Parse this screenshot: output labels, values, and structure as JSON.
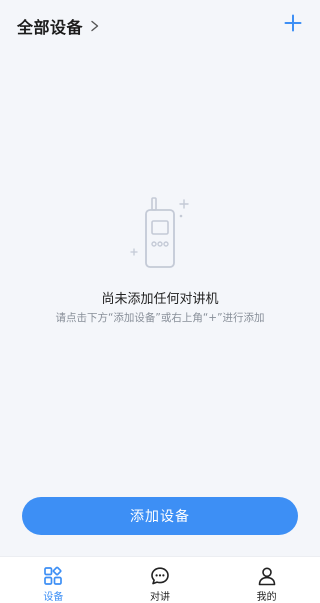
{
  "header": {
    "title": "全部设备"
  },
  "empty_state": {
    "title": "尚未添加任何对讲机",
    "hint": "请点击下方“添加设备”或右上角“+”进行添加"
  },
  "add_device_button": {
    "label": "添加设备"
  },
  "tabbar": {
    "tabs": [
      {
        "label": "设备",
        "icon": "devices-icon",
        "active": true
      },
      {
        "label": "对讲",
        "icon": "chat-icon",
        "active": false
      },
      {
        "label": "我的",
        "icon": "user-icon",
        "active": false
      }
    ]
  },
  "colors": {
    "accent": "#3d8ff5",
    "background": "#f4f6fa",
    "illustration": "#c4cad6"
  }
}
